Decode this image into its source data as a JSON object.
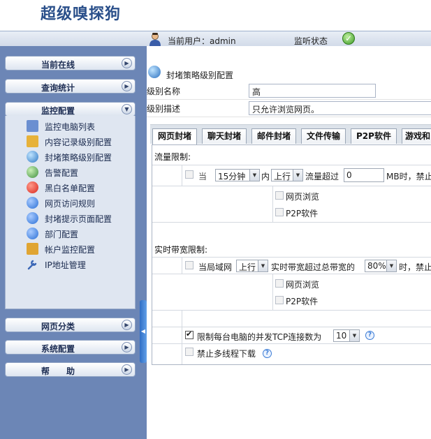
{
  "app": {
    "title": "超级嗅探狗"
  },
  "header": {
    "current_user_label": "当前用户：admin",
    "monitor_status_label": "监听状态",
    "status_ok_icon": "check-circle-icon"
  },
  "sidebar": {
    "current_online": "当前在线",
    "query_stats": "查询统计",
    "monitor_config": "监控配置",
    "monitor_items": [
      {
        "label": "监控电脑列表",
        "icon": "computer-list-icon",
        "color": "#6b8fd1"
      },
      {
        "label": "内容记录级别配置",
        "icon": "folder-record-icon",
        "color": "#e7b23a"
      },
      {
        "label": "封堵策略级别配置",
        "icon": "globe-block-icon",
        "color": "#2f78c4"
      },
      {
        "label": "告警配置",
        "icon": "globe-alert-icon",
        "color": "#3f8f3f"
      },
      {
        "label": "黑白名单配置",
        "icon": "stop-icon",
        "color": "#d9261c"
      },
      {
        "label": "网页访问规则",
        "icon": "check-blue-icon",
        "color": "#2a6fd6"
      },
      {
        "label": "封堵提示页面配置",
        "icon": "tip-page-icon",
        "color": "#2a6fd6"
      },
      {
        "label": "部门配置",
        "icon": "department-icon",
        "color": "#2a6fd6"
      },
      {
        "label": "帐户监控配置",
        "icon": "account-icon",
        "color": "#e0a533"
      },
      {
        "label": "IP地址管理",
        "icon": "wrench-icon",
        "color": "#3a66b5"
      }
    ],
    "web_category": "网页分类",
    "system_config": "系统配置",
    "help": "帮　　助"
  },
  "main": {
    "section_title": "封堵策略级别配置",
    "level_name_label": "级别名称",
    "level_name_value": "高",
    "level_desc_label": "级别描述",
    "level_desc_value": "只允许浏览网页。",
    "tabs": [
      "网页封堵",
      "聊天封堵",
      "邮件封堵",
      "文件传输",
      "P2P软件",
      "游戏和"
    ],
    "traffic": {
      "title": "流量限制:",
      "when": "当",
      "period": "15分钟",
      "in": "内",
      "direction": "上行",
      "exceeds": "流量超过",
      "mb_value": "0",
      "suffix": "MB时，禁止",
      "opt1": "网页浏览",
      "opt2": "P2P软件"
    },
    "bandwidth": {
      "title": "实时带宽限制:",
      "lan": "当局域网",
      "direction": "上行",
      "exceeds": "实时带宽超过总带宽的",
      "percent": "80%",
      "suffix": "时，禁止",
      "opt1": "网页浏览",
      "opt2": "P2P软件"
    },
    "tcp_limit": {
      "label": "限制每台电脑的并发TCP连接数为",
      "value": "10"
    },
    "multithread": {
      "label": "禁止多线程下载"
    }
  }
}
